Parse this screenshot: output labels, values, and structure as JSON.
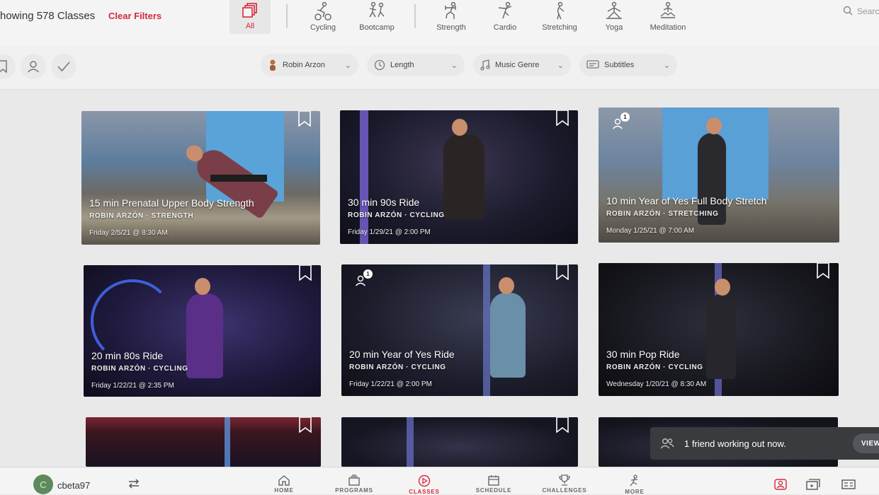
{
  "header": {
    "showing_text": "howing 578 Classes",
    "clear_filters": "Clear Filters",
    "search_placeholder": "Searc",
    "categories": [
      {
        "label": "All",
        "icon": "all-classes-icon",
        "active": true
      },
      {
        "label": "Cycling",
        "icon": "cycling-icon"
      },
      {
        "label": "Bootcamp",
        "icon": "bootcamp-icon"
      },
      {
        "label": "Strength",
        "icon": "strength-icon"
      },
      {
        "label": "Cardio",
        "icon": "cardio-icon"
      },
      {
        "label": "Stretching",
        "icon": "stretching-icon"
      },
      {
        "label": "Yoga",
        "icon": "yoga-icon"
      },
      {
        "label": "Meditation",
        "icon": "meditation-icon"
      }
    ]
  },
  "filters": {
    "instructor": "Robin Arzon",
    "length": "Length",
    "music_genre": "Music Genre",
    "subtitles": "Subtitles"
  },
  "classes": [
    {
      "title": "15 min Prenatal Upper Body Strength",
      "instructor": "ROBIN ARZÓN",
      "type": "STRENGTH",
      "date": "Friday 2/5/21 @ 8:30 AM"
    },
    {
      "title": "30 min 90s Ride",
      "instructor": "ROBIN ARZÓN",
      "type": "CYCLING",
      "date": "Friday 1/29/21 @ 2:00 PM"
    },
    {
      "title": "10 min Year of Yes Full Body Stretch",
      "instructor": "ROBIN ARZÓN",
      "type": "STRETCHING",
      "date": "Monday 1/25/21 @ 7:00 AM",
      "friends": "1"
    },
    {
      "title": "20 min 80s Ride",
      "instructor": "ROBIN ARZÓN",
      "type": "CYCLING",
      "date": "Friday 1/22/21 @ 2:35 PM"
    },
    {
      "title": "20 min Year of Yes Ride",
      "instructor": "ROBIN ARZÓN",
      "type": "CYCLING",
      "date": "Friday 1/22/21 @ 2:00 PM",
      "friends": "1"
    },
    {
      "title": "30 min Pop Ride",
      "instructor": "ROBIN ARZÓN",
      "type": "CYCLING",
      "date": "Wednesday 1/20/21 @ 8:30 AM"
    }
  ],
  "toast": {
    "text": "1 friend working out now.",
    "action": "VIEW"
  },
  "bottom_nav": {
    "avatar_initial": "C",
    "username": "cbeta97",
    "items": [
      {
        "label": "HOME",
        "icon": "home-icon"
      },
      {
        "label": "PROGRAMS",
        "icon": "programs-icon"
      },
      {
        "label": "CLASSES",
        "icon": "classes-icon",
        "active": true
      },
      {
        "label": "SCHEDULE",
        "icon": "schedule-icon"
      },
      {
        "label": "CHALLENGES",
        "icon": "challenges-icon"
      },
      {
        "label": "MORE",
        "icon": "more-icon"
      }
    ]
  },
  "colors": {
    "accent": "#d6283a",
    "toast_bg": "#3a3b3f"
  }
}
